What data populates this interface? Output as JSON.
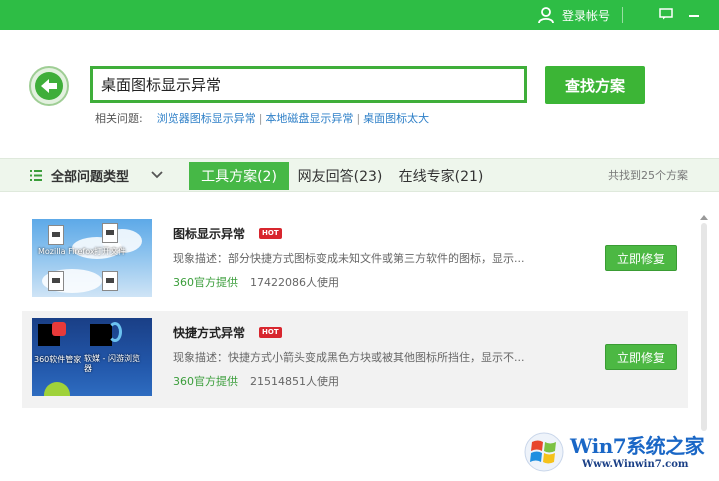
{
  "titlebar": {
    "login_label": "登录帐号",
    "icons": [
      "user-icon",
      "feedback-icon",
      "minimize-icon"
    ]
  },
  "search": {
    "query": "桌面图标显示异常",
    "button_label": "查找方案"
  },
  "related": {
    "label": "相关问题:",
    "links": [
      "浏览器图标显示异常",
      "本地磁盘显示异常",
      "桌面图标太大"
    ],
    "separator": "|"
  },
  "tabs": {
    "category_label": "全部问题类型",
    "items": [
      {
        "label": "工具方案(2)",
        "active": true
      },
      {
        "label": "网友回答(23)",
        "active": false
      },
      {
        "label": "在线专家(21)",
        "active": false
      }
    ],
    "found_text": "共找到25个方案"
  },
  "results": [
    {
      "title": "图标显示异常",
      "badge": "HOT",
      "description": "现象描述：部分快捷方式图标变成未知文件或第三方软件的图标，显示...",
      "source": "360官方提供",
      "usage": "17422086人使用",
      "fix_label": "立即修复",
      "thumb_labels": [
        "Mozilla Firefox",
        "打开文件"
      ]
    },
    {
      "title": "快捷方式异常",
      "badge": "HOT",
      "description": "现象描述：快捷方式小箭头变成黑色方块或被其他图标所挡住，显示不...",
      "source": "360官方提供",
      "usage": "21514851人使用",
      "fix_label": "立即修复",
      "thumb_labels": [
        "360软件管家",
        "软媒 - 闪游浏览器"
      ]
    }
  ],
  "watermark": {
    "brand": "Win7系统之家",
    "url": "Www.Winwin7.com"
  },
  "colors": {
    "brand_green": "#2ebd45",
    "button_green": "#3cb536",
    "link_blue": "#2f80c8",
    "hot_red": "#d8262e"
  }
}
